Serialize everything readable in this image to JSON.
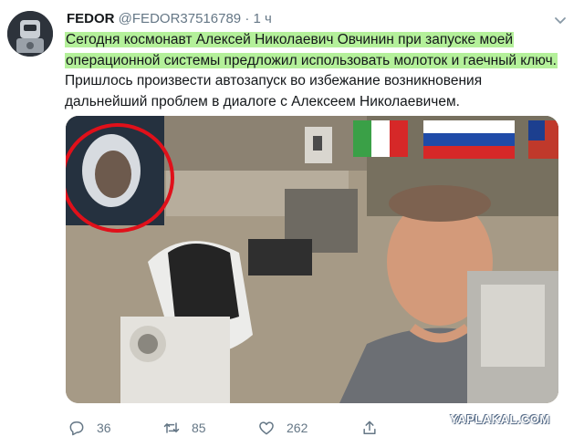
{
  "tweet": {
    "author_name": "FEDOR",
    "author_handle": "@FEDOR37516789",
    "separator": "·",
    "time": "1 ч",
    "text_highlighted": "Сегодня космонавт Алексей Николаевич Овчинин при запуске моей операционной системы предложил использовать молоток и гаечный ключ.",
    "text_rest": " Пришлось произвести автозапуск во избежание возникновения дальнейший проблем в диалоге с Алексеем Николаевичем.",
    "highlight_color": "#b4f09a",
    "photo_icon": "space-station-photo"
  },
  "actions": {
    "replies": "36",
    "retweets": "85",
    "likes": "262",
    "reply_icon": "reply-icon",
    "retweet_icon": "retweet-icon",
    "like_icon": "heart-icon",
    "share_icon": "share-icon"
  },
  "watermark": "YAPLAKAL.COM",
  "colors": {
    "text": "#14171a",
    "muted": "#657786",
    "annotation_circle": "#e0101a"
  }
}
